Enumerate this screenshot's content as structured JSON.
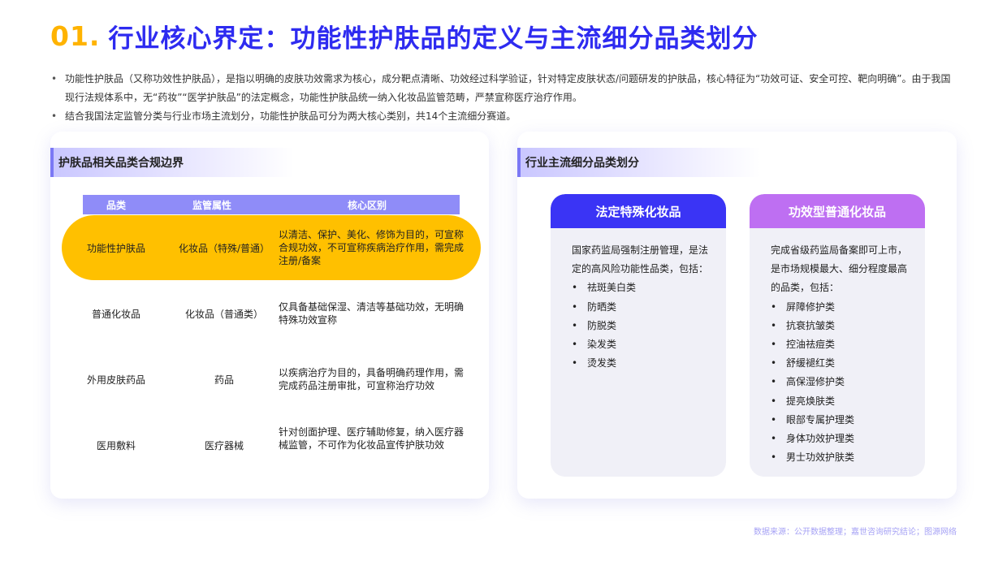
{
  "header": {
    "number": "01.",
    "title": "行业核心界定：功能性护肤品的定义与主流细分品类划分"
  },
  "intro": [
    "功能性护肤品（又称功效性护肤品），是指以明确的皮肤功效需求为核心，成分靶点清晰、功效经过科学验证，针对特定皮肤状态/问题研发的护肤品，核心特征为“功效可证、安全可控、靶向明确”。由于我国现行法规体系中，无“药妆”“医学护肤品”的法定概念，功能性护肤品统一纳入化妆品监管范畴，严禁宣称医疗治疗作用。",
    "结合我国法定监管分类与行业市场主流划分，功能性护肤品可分为两大核心类别，共14个主流细分赛道。"
  ],
  "left_panel": {
    "title": "护肤品相关品类合规边界",
    "columns": [
      "品类",
      "监管属性",
      "核心区别"
    ],
    "rows": [
      {
        "category": "功能性护肤品",
        "attribute": "化妆品（特殊/普通）",
        "difference": "以清洁、保护、美化、修饰为目的，可宣称合规功效，不可宣称疾病治疗作用，需完成注册/备案"
      },
      {
        "category": "普通化妆品",
        "attribute": "化妆品（普通类）",
        "difference": "仅具备基础保湿、清洁等基础功效，无明确特殊功效宣称"
      },
      {
        "category": "外用皮肤药品",
        "attribute": "药品",
        "difference": "以疾病治疗为目的，具备明确药理作用，需完成药品注册审批，可宣称治疗功效"
      },
      {
        "category": "医用敷料",
        "attribute": "医疗器械",
        "difference": "针对创面护理、医疗辅助修复，纳入医疗器械监管，不可作为化妆品宣传护肤功效"
      }
    ]
  },
  "right_panel": {
    "title": "行业主流细分品类划分",
    "cards": [
      {
        "title": "法定特殊化妆品",
        "desc": "国家药监局强制注册管理，是法定的高风险功能性品类，包括：",
        "items": [
          "祛斑美白类",
          "防晒类",
          "防脱类",
          "染发类",
          "烫发类"
        ]
      },
      {
        "title": "功效型普通化妆品",
        "desc": "完成省级药监局备案即可上市，是市场规模最大、细分程度最高的品类，包括：",
        "items": [
          "屏障修护类",
          "抗衰抗皱类",
          "控油祛痘类",
          "舒缓褪红类",
          "高保湿修护类",
          "提亮焕肤类",
          "眼部专属护理类",
          "身体功效护理类",
          "男士功效护肤类"
        ]
      }
    ]
  },
  "footer": {
    "source": "数据来源：公开数据整理；嘉世咨询研究结论；图源网络"
  },
  "colors": {
    "title_blue": "#2E2BF0",
    "accent_yellow": "#FFC000",
    "header_purple": "#8F8CF8",
    "card_blue": "#3A34F5",
    "card_violet": "#BE6FF2"
  }
}
